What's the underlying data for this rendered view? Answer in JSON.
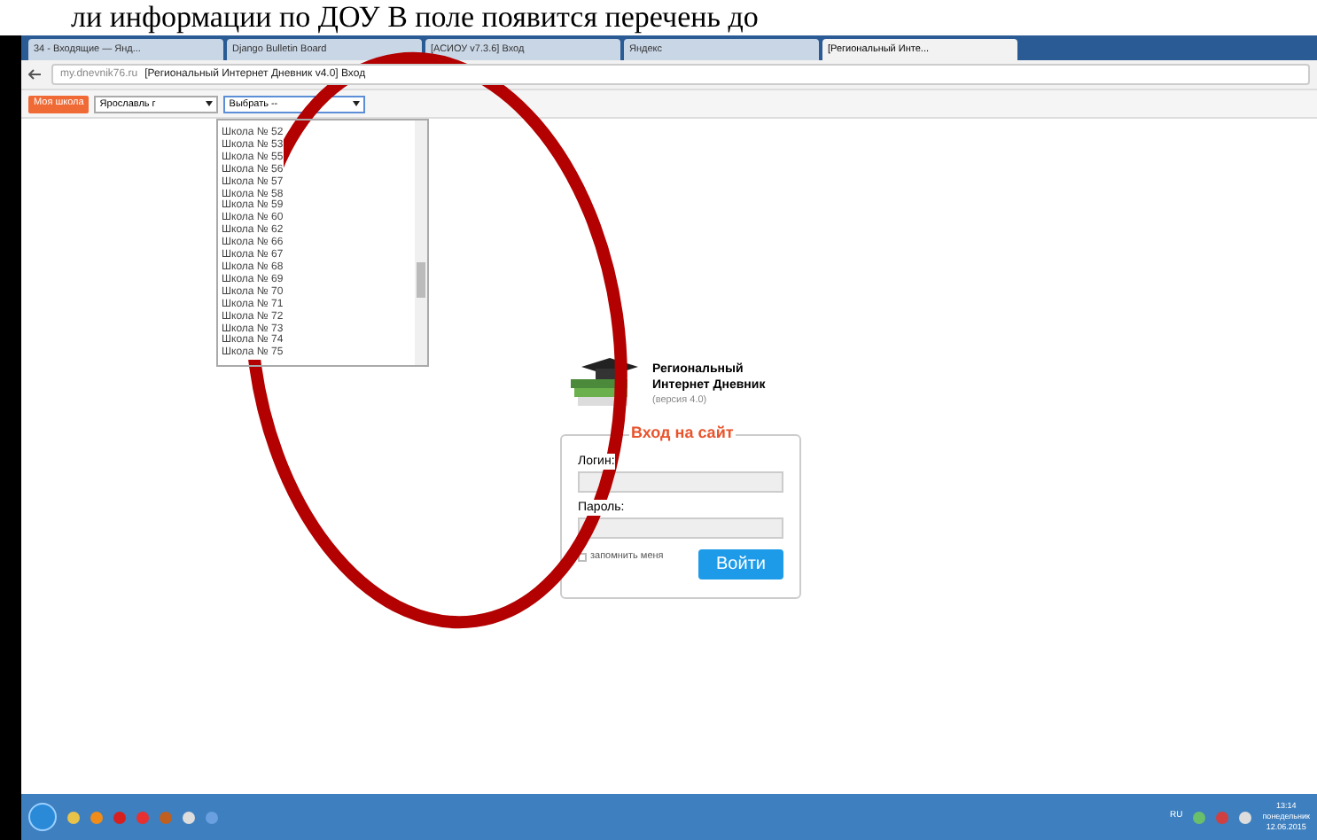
{
  "caption": "ли информации по ДОУ  В поле появится перечень до",
  "tabs": [
    {
      "label": "34 - Входящие — Янд...",
      "selected": false
    },
    {
      "label": "Django Bulletin Board",
      "selected": false
    },
    {
      "label": "[АСИОУ v7.3.6] Вход",
      "selected": false
    },
    {
      "label": "Яндекс",
      "selected": false
    },
    {
      "label": "[Региональный Инте...",
      "selected": true
    }
  ],
  "address": {
    "host": "my.dnevnik76.ru",
    "title": "[Региональный Интернет Дневник v4.0] Вход"
  },
  "toolbar": {
    "button": "Моя школа",
    "city": "Ярославль г",
    "school": "Выбрать --"
  },
  "school_list": [
    "Школа № 52",
    "Школа № 53",
    "Школа № 55",
    "Школа № 56",
    "Школа № 57",
    "Школа № 58",
    "Школа № 59",
    "Школа № 60",
    "Школа № 62",
    "Школа № 66",
    "Школа № 67",
    "Школа № 68",
    "Школа № 69",
    "Школа № 70",
    "Школа № 71",
    "Школа № 72",
    "Школа № 73",
    "Школа № 74",
    "Школа № 75"
  ],
  "site": {
    "title": "Региональный Интернет Дневник",
    "version": "(версия 4.0)"
  },
  "login": {
    "legend": "Вход на сайт",
    "login_label": "Логин:",
    "password_label": "Пароль:",
    "remember": {
      "label": "запомнить меня",
      "checked": false
    },
    "submit": "Войти"
  },
  "taskbar": {
    "lang": "RU",
    "time": "13:14",
    "day": "понедельник",
    "date": "12.06.2015"
  }
}
